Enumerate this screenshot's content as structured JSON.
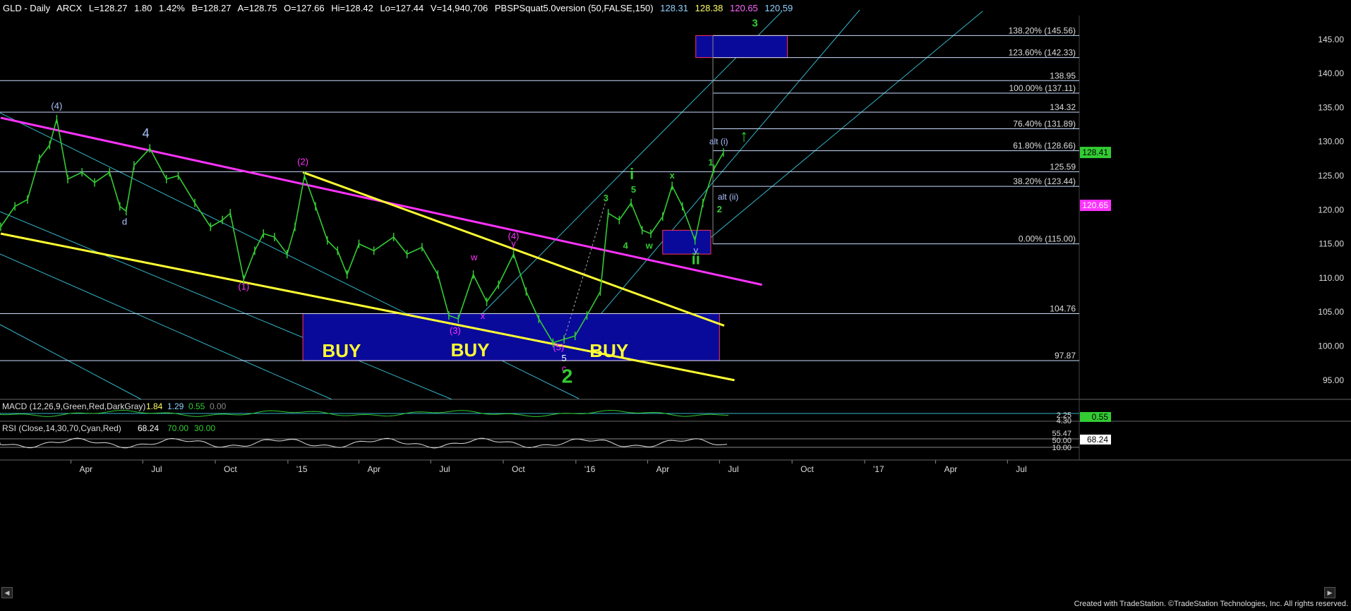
{
  "header": {
    "symbol": "GLD - Daily",
    "exchange": "ARCX",
    "last": "L=128.27",
    "chg": "1.80",
    "pct": "1.42%",
    "bid": "B=128.27",
    "ask": "A=128.75",
    "open": "O=127.66",
    "hi": "Hi=128.42",
    "lo": "Lo=127.44",
    "vol": "V=14,940,706",
    "indicator": "PBSPSquat5.0version (50,FALSE,150)",
    "ind_vals": [
      "128.31",
      "128.38",
      "120.65",
      "120.59"
    ],
    "ind_colors": [
      "#8fd3ff",
      "#ffff66",
      "#ff66ff",
      "#8fd3ff"
    ]
  },
  "footer": "Created with TradeStation. ©TradeStation Technologies, Inc. All rights reserved.",
  "colors": {
    "bg": "#000000",
    "price": "#33cc33",
    "magenta": "#ff33ff",
    "yellow": "#ffff33",
    "cyan": "#33b5c9",
    "hline": "#c8dcff",
    "box": "#0a0a9a",
    "boxEdge": "#ff3355",
    "green": "#33cc33"
  },
  "chart_data": [
    {
      "type": "line",
      "title": "GLD - Daily ARCX",
      "x_ticks": [
        "Apr",
        "Jul",
        "Oct",
        "'15",
        "Apr",
        "Jul",
        "Oct",
        "'16",
        "Apr",
        "Jul",
        "Oct",
        "'17",
        "Apr",
        "Jul"
      ],
      "y_ticks": [
        "95.00",
        "100.00",
        "105.00",
        "110.00",
        "115.00",
        "120.00",
        "125.00",
        "130.00",
        "135.00",
        "140.00",
        "145.00"
      ],
      "ylim": [
        92.5,
        148.5
      ],
      "series": [
        {
          "name": "GLD",
          "points": [
            [
              "2014-01-02",
              117.5
            ],
            [
              "2014-01-20",
              120.5
            ],
            [
              "2014-02-05",
              121.5
            ],
            [
              "2014-02-20",
              127.5
            ],
            [
              "2014-03-05",
              129.5
            ],
            [
              "2014-03-14",
              133.3
            ],
            [
              "2014-03-28",
              124.5
            ],
            [
              "2014-04-15",
              125.5
            ],
            [
              "2014-05-01",
              124.0
            ],
            [
              "2014-05-20",
              125.5
            ],
            [
              "2014-06-02",
              120.5
            ],
            [
              "2014-06-10",
              119.8
            ],
            [
              "2014-06-20",
              126.5
            ],
            [
              "2014-07-10",
              129.0
            ],
            [
              "2014-07-31",
              124.5
            ],
            [
              "2014-08-15",
              125.0
            ],
            [
              "2014-09-05",
              121.0
            ],
            [
              "2014-09-25",
              117.5
            ],
            [
              "2014-10-10",
              118.5
            ],
            [
              "2014-10-20",
              119.5
            ],
            [
              "2014-11-06",
              109.8
            ],
            [
              "2014-11-20",
              114.0
            ],
            [
              "2014-12-01",
              116.5
            ],
            [
              "2014-12-15",
              116.0
            ],
            [
              "2014-12-31",
              113.5
            ],
            [
              "2015-01-10",
              117.5
            ],
            [
              "2015-01-22",
              125.0
            ],
            [
              "2015-02-05",
              120.5
            ],
            [
              "2015-02-20",
              115.5
            ],
            [
              "2015-03-05",
              114.0
            ],
            [
              "2015-03-17",
              110.5
            ],
            [
              "2015-04-01",
              115.0
            ],
            [
              "2015-04-20",
              114.0
            ],
            [
              "2015-05-15",
              116.0
            ],
            [
              "2015-06-01",
              113.5
            ],
            [
              "2015-06-20",
              114.5
            ],
            [
              "2015-07-10",
              110.5
            ],
            [
              "2015-07-24",
              104.5
            ],
            [
              "2015-08-05",
              104.0
            ],
            [
              "2015-08-24",
              110.5
            ],
            [
              "2015-09-10",
              106.5
            ],
            [
              "2015-09-25",
              109.0
            ],
            [
              "2015-10-14",
              113.5
            ],
            [
              "2015-10-30",
              108.0
            ],
            [
              "2015-11-15",
              104.0
            ],
            [
              "2015-12-03",
              100.5
            ],
            [
              "2015-12-17",
              101.0
            ],
            [
              "2015-12-31",
              101.5
            ],
            [
              "2016-01-15",
              104.5
            ],
            [
              "2016-02-01",
              108.0
            ],
            [
              "2016-02-11",
              119.5
            ],
            [
              "2016-02-25",
              118.5
            ],
            [
              "2016-03-11",
              121.0
            ],
            [
              "2016-03-25",
              117.0
            ],
            [
              "2016-04-05",
              116.5
            ],
            [
              "2016-04-20",
              119.0
            ],
            [
              "2016-05-02",
              123.5
            ],
            [
              "2016-05-15",
              120.5
            ],
            [
              "2016-05-31",
              115.5
            ],
            [
              "2016-06-10",
              121.0
            ],
            [
              "2016-06-24",
              126.0
            ],
            [
              "2016-07-06",
              128.4
            ]
          ]
        },
        {
          "name": "Magenta Trendline",
          "points": [
            [
              "2014-01-02",
              133.5
            ],
            [
              "2016-08-24",
              109.0
            ]
          ]
        },
        {
          "name": "Yellow Trendline Lower",
          "points": [
            [
              "2014-01-02",
              116.5
            ],
            [
              "2016-07-20",
              95.0
            ]
          ]
        },
        {
          "name": "Yellow Trendline Upper",
          "points": [
            [
              "2015-01-20",
              125.5
            ],
            [
              "2016-07-07",
              103.0
            ]
          ]
        }
      ],
      "price_levels": [
        {
          "label": "138.20% (145.56)",
          "value": 145.56
        },
        {
          "label": "123.60% (142.33)",
          "value": 142.33
        },
        {
          "label": "138.95",
          "value": 138.95
        },
        {
          "label": "100.00% (137.11)",
          "value": 137.11
        },
        {
          "label": "134.32",
          "value": 134.32
        },
        {
          "label": "76.40% (131.89)",
          "value": 131.89
        },
        {
          "label": "61.80% (128.66)",
          "value": 128.66
        },
        {
          "label": "125.59",
          "value": 125.59
        },
        {
          "label": "38.20% (123.44)",
          "value": 123.44
        },
        {
          "label": "0.00% (115.00)",
          "value": 115.0
        },
        {
          "label": "104.76",
          "value": 104.76
        },
        {
          "label": "97.87",
          "value": 97.87
        }
      ],
      "current_price_tags": [
        {
          "label": "128.41",
          "value": 128.41
        },
        {
          "label": "120.65",
          "value": 120.65
        }
      ],
      "boxes": [
        {
          "x": [
            "2015-01-20",
            "2016-07-01"
          ],
          "y": [
            97.87,
            104.76
          ]
        },
        {
          "x": [
            "2016-06-01",
            "2016-09-25"
          ],
          "y": [
            142.33,
            145.56
          ]
        },
        {
          "x": [
            "2016-04-20",
            "2016-06-20"
          ],
          "y": [
            113.5,
            117.0
          ]
        }
      ],
      "annotations": [
        {
          "text": "BUY",
          "x": "2015-03-10",
          "y": 98.4
        },
        {
          "text": "BUY",
          "x": "2015-08-20",
          "y": 98.5
        },
        {
          "text": "BUY",
          "x": "2016-02-12",
          "y": 98.4
        },
        {
          "text": "(4)",
          "x": "2014-03-14",
          "y": 134.8
        },
        {
          "text": "4",
          "x": "2014-07-05",
          "y": 130.6
        },
        {
          "text": "d",
          "x": "2014-06-08",
          "y": 117.8
        },
        {
          "text": "(1)",
          "x": "2014-11-06",
          "y": 108.3
        },
        {
          "text": "(2)",
          "x": "2015-01-20",
          "y": 126.6
        },
        {
          "text": "(3)",
          "x": "2015-08-01",
          "y": 101.8
        },
        {
          "text": "w",
          "x": "2015-08-25",
          "y": 112.6
        },
        {
          "text": "x",
          "x": "2015-09-05",
          "y": 104.0
        },
        {
          "text": "(4)",
          "x": "2015-10-14",
          "y": 115.7
        },
        {
          "text": "y",
          "x": "2015-10-14",
          "y": 114.6
        },
        {
          "text": "(5)",
          "x": "2015-12-10",
          "y": 99.4
        },
        {
          "text": "5",
          "x": "2015-12-17",
          "y": 97.8
        },
        {
          "text": "c",
          "x": "2015-12-17",
          "y": 96.3
        },
        {
          "text": "2",
          "x": "2015-12-21",
          "y": 94.6
        },
        {
          "text": "3",
          "x": "2016-02-08",
          "y": 121.3
        },
        {
          "text": "i",
          "x": "2016-03-12",
          "y": 124.5
        },
        {
          "text": "5",
          "x": "2016-03-14",
          "y": 122.5
        },
        {
          "text": "4",
          "x": "2016-03-04",
          "y": 114.3
        },
        {
          "text": "w",
          "x": "2016-04-03",
          "y": 114.3
        },
        {
          "text": "x",
          "x": "2016-05-02",
          "y": 124.6
        },
        {
          "text": "y",
          "x": "2016-06-01",
          "y": 113.6
        },
        {
          "text": "ii",
          "x": "2016-06-01",
          "y": 112.0
        },
        {
          "text": "1",
          "x": "2016-06-20",
          "y": 126.5
        },
        {
          "text": "2",
          "x": "2016-07-01",
          "y": 119.6
        },
        {
          "text": "alt (i)",
          "x": "2016-06-30",
          "y": 129.6
        },
        {
          "text": "alt (ii)",
          "x": "2016-07-12",
          "y": 121.5
        },
        {
          "text": "3",
          "x": "2016-08-15",
          "y": 146.9
        }
      ]
    },
    {
      "type": "line",
      "title": "MACD (12,26,9,Green,Red,DarkGray)",
      "values": [
        "1.84",
        "1.29",
        "0.55",
        "0.00"
      ],
      "value_colors": [
        "#ffff66",
        "#8fd3ff",
        "#33cc33",
        "#888888"
      ],
      "axis_labels": [
        "2.25",
        "4.30"
      ],
      "current": "0.55"
    },
    {
      "type": "line",
      "title": "RSI (Close,14,30,70,Cyan,Red)",
      "values": [
        "68.24",
        "70.00",
        "30.00"
      ],
      "value_colors": [
        "#ffffff",
        "#33cc33",
        "#33cc33"
      ],
      "axis_labels": [
        "55.47",
        "50.00",
        "10.00"
      ],
      "current": "68.24"
    }
  ]
}
